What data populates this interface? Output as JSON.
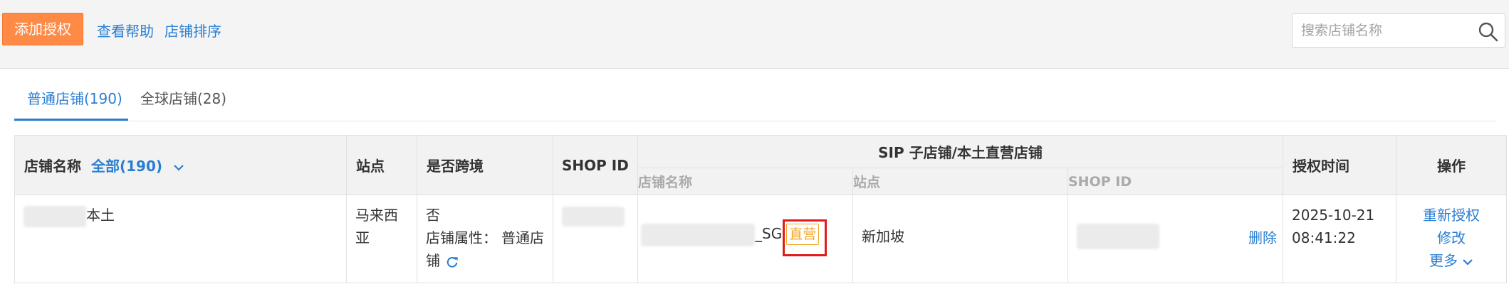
{
  "toolbar": {
    "add_button": "添加授权",
    "help_link": "查看帮助",
    "sort_link": "店铺排序",
    "search_placeholder": "搜索店铺名称"
  },
  "tabs": [
    {
      "label": "普通店铺(190)",
      "active": true
    },
    {
      "label": "全球店铺(28)",
      "active": false
    }
  ],
  "table": {
    "headers": {
      "store_name": "店铺名称",
      "store_filter": "全部(190)",
      "site": "站点",
      "cross_border": "是否跨境",
      "shop_id": "SHOP ID",
      "sip_group": "SIP 子店铺/本土直营店铺",
      "sip_store_name": "店铺名称",
      "sip_site": "站点",
      "sip_shop_id": "SHOP ID",
      "auth_time": "授权时间",
      "actions": "操作"
    },
    "rows": [
      {
        "store_name_suffix": "本土",
        "site": "马来西亚",
        "cross_border": "否",
        "store_attr_label": "店铺属性：",
        "store_attr_value": "普通店铺",
        "sip_store_suffix": "_SG",
        "sip_badge": "直营",
        "sip_site": "新加坡",
        "sip_delete": "删除",
        "auth_time": "2025-10-21 08:41:22",
        "action_reauth": "重新授权",
        "action_edit": "修改",
        "action_more": "更多"
      }
    ]
  },
  "colors": {
    "accent": "#2a7ed2",
    "add_button": "#ff8a45",
    "badge": "#f5a623",
    "highlight": "#e01b1b"
  }
}
